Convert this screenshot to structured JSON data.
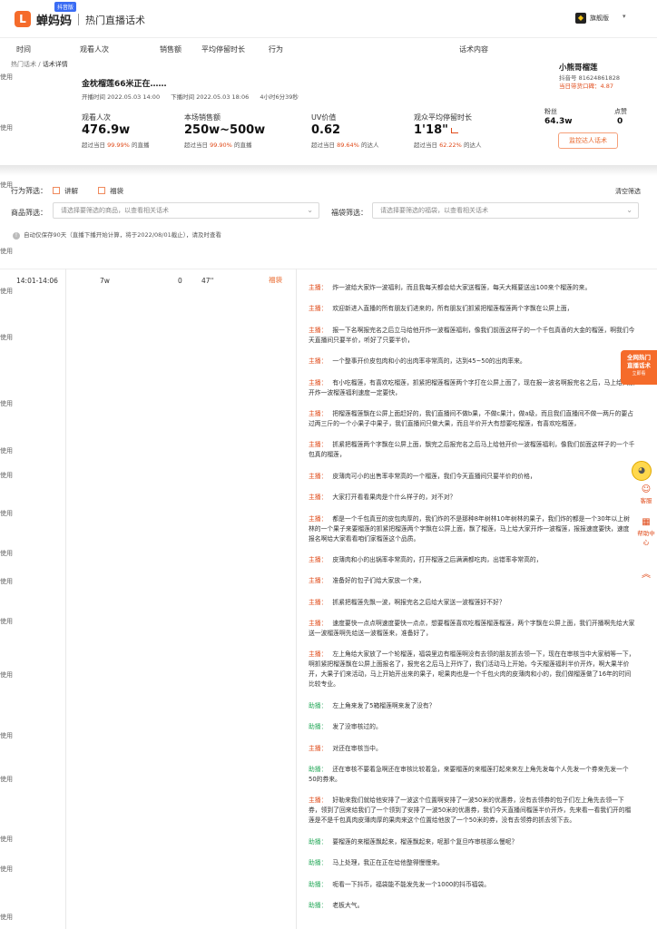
{
  "header": {
    "logo_char": "L",
    "brand": "蝉妈妈",
    "badge": "抖音版",
    "page_name": "热门直播话术",
    "user_name": "旗舰版",
    "user_caret": "▾"
  },
  "columns": [
    "时间",
    "观看人次",
    "销售额",
    "平均停留时长",
    "行为",
    "话术内容"
  ],
  "left_labels": [
    "使用",
    "使用",
    "使用",
    "使用",
    "使用",
    "使用",
    "使用",
    "使用",
    "使用",
    "使用",
    "使用",
    "使用",
    "使用",
    "使用",
    "使用",
    "使用",
    "使用",
    "使用",
    "使用",
    "使用",
    "使用",
    "使用"
  ],
  "breadcrumb": {
    "parent": "热门话术 / ",
    "current": "话术详情"
  },
  "live": {
    "title": "金枕榴莲66米正在……",
    "start": "开播时间 2022.05.03 14:00",
    "end": "下播时间 2022.05.03 18:06",
    "duration": "4小时6分39秒"
  },
  "anchor": {
    "name": "小熊哥榴莲",
    "douyin_id": "抖音号 81624861828",
    "rank": "当日带货口碑：4.87"
  },
  "stats": [
    {
      "title": "观看人次",
      "value": "476.9w",
      "pre": "超过当日 ",
      "pct": "99.99%",
      "post": " 的直播"
    },
    {
      "title": "本场销售额",
      "value": "250w~500w",
      "pre": "超过当日 ",
      "pct": "99.90%",
      "post": " 的直播"
    },
    {
      "title": "UV价值",
      "value": "0.62",
      "pre": "超过当日 ",
      "pct": "89.64%",
      "post": " 的达人"
    },
    {
      "title": "观众平均停留时长",
      "value": "1'18\"",
      "pre": "超过当日 ",
      "pct": "62.22%",
      "post": " 的达人"
    }
  ],
  "fans": {
    "label": "粉丝",
    "value": "64.3w",
    "likes_label": "点赞",
    "likes_value": "0"
  },
  "monitor_button": "监控达人话术",
  "filters": {
    "behavior_label": "行为筛选：",
    "opt1": "讲解",
    "opt2": "福袋",
    "clear": "清空筛选",
    "goods_label": "商品筛选：",
    "goods_placeholder": "请选择要筛选的商品，以查看相关话术",
    "bag_label": "福袋筛选：",
    "bag_placeholder": "请选择要筛选的福袋，以查看相关话术",
    "arrow": "⌄"
  },
  "notice": "自动仅保存90天（直播下播开始计算，将于2022/08/01截止），请及时查看",
  "row": {
    "time": "14:01-14:06",
    "views": "7w",
    "sales": "0",
    "stay": "47''",
    "action": "福袋"
  },
  "transcript": [
    {
      "speaker": "主播：",
      "type": "host",
      "text": "炸一波给大家炸一波福利，而且我每天都会给大家送榴莲，每天大概要送出100来个榴莲的来。"
    },
    {
      "speaker": "主播：",
      "type": "host",
      "text": "欢迎新进入直播的所有朋友们进来的，所有朋友们抓紧把榴莲榴莲两个字飘在公屏上面，"
    },
    {
      "speaker": "主播：",
      "type": "host",
      "text": "报一下名啊报完名之后立马给他开炸一波榴莲福利，像我们前面这样子的一个千包真香的大金的榴莲，啊我们今天直播间只要半价，听好了只要半价，"
    },
    {
      "speaker": "主播：",
      "type": "host",
      "text": "一个整事开价皮包肉和小的出肉率非常高的，达到45~50的出肉率来。"
    },
    {
      "speaker": "主播：",
      "type": "host",
      "text": "有小吃榴莲，有喜欢吃榴莲，抓紧把榴莲榴莲两个字打在公屏上面了，现在报一波名啊报完名之后，马上给大家开炸一波榴莲福利速度一定要快，"
    },
    {
      "speaker": "主播：",
      "type": "host",
      "text": "把榴莲榴莲飘在公屏上面赶好的，我们直播间不做b果，不做c果汁，做a级，而且我们直播间不做一两斤的要占过两三斤的一个小果子中果子，我们直播间只做大果，而且半价开大有想要吃榴莲，有喜欢吃榴莲，"
    },
    {
      "speaker": "主播：",
      "type": "host",
      "text": "抓紧把榴莲两个字飘在公屏上面，飘完之后报完名之后马上给他开价一波榴莲福利，像我们前面这样子的一个千包真的榴莲，"
    },
    {
      "speaker": "主播：",
      "type": "host",
      "text": "皮薄肉可小的出售率非常高的一个榴莲，我们今天直播间只要半价的价格，"
    },
    {
      "speaker": "主播：",
      "type": "host",
      "text": "大家打开看看果肉是个什么样子的，对不对？"
    },
    {
      "speaker": "主播：",
      "type": "host",
      "text": "都是一个千包真豆的皮包肉厚的，我们炸的不是那种8年树林10年树林的果子，我们炸的都是一个30年以上树林的一个果子来要榴莲的抓紧把榴莲两个字飘在公屏上面，飘了榴莲，马上给大家开炸一波榴莲，报报速度要快，速度报名啊给大家看看咱们家榴莲这个品质。"
    },
    {
      "speaker": "主播：",
      "type": "host",
      "text": "皮薄肉和小的出锅率非常高的，打开榴莲之后满满都吃肉，出错率非常高的，"
    },
    {
      "speaker": "主播：",
      "type": "host",
      "text": "准备好的包子们给大家放一个来，"
    },
    {
      "speaker": "主播：",
      "type": "host",
      "text": "抓紧把榴莲先飘一波，啊报完名之后给大家送一波榴莲好不好？"
    },
    {
      "speaker": "主播：",
      "type": "host",
      "text": "速度要快一点点啊速度要快一点点，想要榴莲喜欢吃榴莲榴莲榴莲，两个字飘在公屏上面，我们开播啊先给大家送一波榴莲啊先给送一波榴莲来，准备好了，"
    },
    {
      "speaker": "主播：",
      "type": "host",
      "text": "左上角给大家放了一个轮榴莲，福袋里边有榴莲啊没有去领的朋友抓去领一下，现在在审核当中大家稍等一下，啊抓紧把榴莲飘在公屏上面报名了，报完名之后马上开炸了，我们活动马上开始，今天榴莲福利半价开炸，啊大果半价开，大果子们来活动，马上开始开出来的果子，呢果肉也是一个千包火肉的皮薄肉和小的，我们做榴莲做了16年的时间比较专业。"
    },
    {
      "speaker": "助播：",
      "type": "help",
      "text": "左上角来发了5箱榴莲啊来发了没有？"
    },
    {
      "speaker": "助播：",
      "type": "help",
      "text": "发了没审核过的。"
    },
    {
      "speaker": "主播：",
      "type": "host",
      "text": "对还在审核当中。"
    },
    {
      "speaker": "助播：",
      "type": "help",
      "text": "还在审核不要着急啊还在审核比较着急，来要榴莲的来榴莲打起来来左上角先发每个人先发一个券来先发一个50的券来。"
    },
    {
      "speaker": "主播：",
      "type": "host",
      "text": "好勒来我们就给他安排了一波这个位置啊安排了一波50米的优惠券，没有去领券的包子们左上角先去领一下券，领到了回来给我们了一个领到了安排了一波50米的优惠券，我们今天直播间榴莲半价开炸，先来看一看我们开的榴莲是不是千包真肉皮薄肉厚的果肉来这个位置给他放了一个50米的券，没有去领券的抓去领下去。"
    },
    {
      "speaker": "助播：",
      "type": "help",
      "text": "要榴莲的来榴莲飘起来，榴莲飘起来，呢那个复旦咋审核那么慢呢？"
    },
    {
      "speaker": "助播：",
      "type": "help",
      "text": "马上处理，我正在正在给他整得慢慢来。"
    },
    {
      "speaker": "助播：",
      "type": "help",
      "text": "呃看一下抖币，福袋能不能发先发一个1000的抖币福袋。"
    },
    {
      "speaker": "助播：",
      "type": "help",
      "text": "老板大气。"
    }
  ],
  "float_card": {
    "line1": "全网热门",
    "line2": "直播话术",
    "line3": "立即看"
  },
  "side_tools": [
    {
      "icon": "☺",
      "label": "客服"
    },
    {
      "icon": "▦",
      "label": "帮助中心"
    },
    {
      "icon": "︽",
      "label": ""
    }
  ],
  "colors": {
    "accent": "#f56b2a",
    "host": "#e04b1a",
    "helper": "#2bab5e"
  }
}
